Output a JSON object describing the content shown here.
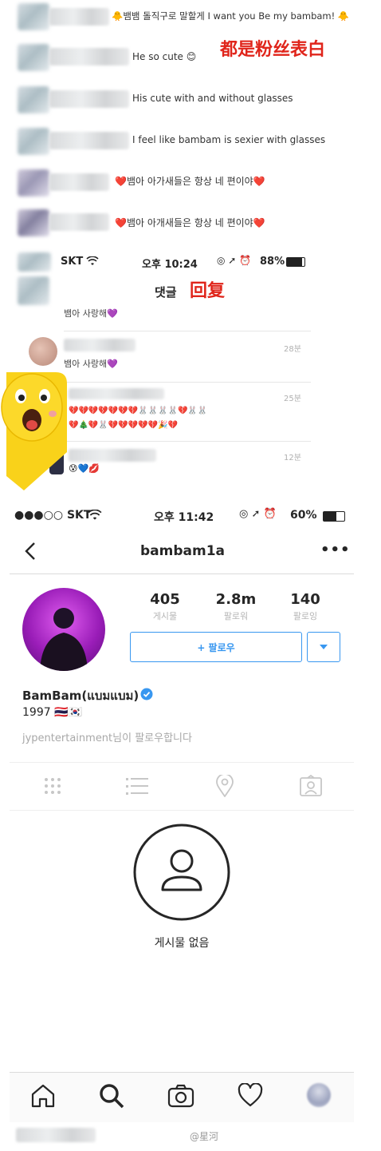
{
  "top_comments": [
    {
      "text": "🐥뱀뱀 돌직구로 말할게 I want you Be my bambam! 🐥"
    },
    {
      "text": "He so  cute 😊"
    },
    {
      "text": "His cute with and without glasses"
    },
    {
      "text": "I feel like  bambam is sexier with glasses"
    },
    {
      "text": "❤️뱀아 아가새들은 항상 네 편이야❤️"
    },
    {
      "text": "❤️뱀아 아개새들은 항상 네 편이야❤️"
    }
  ],
  "annotations": {
    "fans_confess": "都是粉丝表白",
    "reply": "回复"
  },
  "mid_status": {
    "carrier": "SKT",
    "time": "오후 10:24",
    "battery": "88%"
  },
  "mid_screen": {
    "title": "댓글",
    "comments": [
      {
        "text": "뱀아 사랑해💜",
        "time": ""
      },
      {
        "text": "뱀아 사랑해💜",
        "time": "28분"
      },
      {
        "text": "💔💔💔💔💔💔💔🐰🐰🐰🐰💔🐰🐰\n💔🎄💔🐰💔💔💔💔💔🎉💔",
        "time": "25분"
      },
      {
        "text": "😰💙💋",
        "time": "12분"
      }
    ]
  },
  "profile_status": {
    "carrier": "●●●○○ SKT",
    "time": "오후 11:42",
    "battery": "60%"
  },
  "profile": {
    "username": "bambam1a",
    "stats": [
      {
        "value": "405",
        "label": "게시물"
      },
      {
        "value": "2.8m",
        "label": "팔로워"
      },
      {
        "value": "140",
        "label": "팔로잉"
      }
    ],
    "follow_label": "+ 팔로우",
    "display_name": "BamBam(แบมแบม)",
    "bio": "1997 🇹🇭🇰🇷",
    "followed_by": "jypentertainment님이 팔로우합니다",
    "empty_text": "게시물 없음"
  },
  "watermark": "@星河"
}
